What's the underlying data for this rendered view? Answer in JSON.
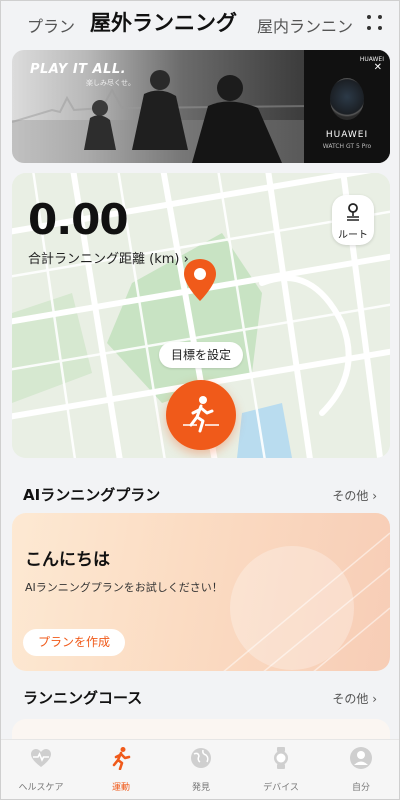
{
  "tabs": [
    {
      "label": "プラン"
    },
    {
      "label": "屋外ランニング"
    },
    {
      "label": "屋内ランニン"
    }
  ],
  "banner": {
    "slogan": "PLAY IT ALL.",
    "slogan_sub": "楽しみ尽くせ。",
    "brand_top": "HUAWEI",
    "brand": "HUAWEI",
    "model": "WATCH GT 5 Pro"
  },
  "run": {
    "distance": "0.00",
    "distance_label": "合計ランニング距離 (km) ›",
    "route_label": "ルート",
    "goal_label": "目標を設定"
  },
  "ai_plan": {
    "title": "AIランニングプラン",
    "more": "その他 ›",
    "greeting": "こんにちは",
    "message": "AIランニングプランをお試しください！",
    "button": "プランを作成"
  },
  "courses": {
    "title": "ランニングコース",
    "more": "その他 ›"
  },
  "nav": [
    {
      "label": "ヘルスケア",
      "icon": "heart-pulse-icon"
    },
    {
      "label": "運動",
      "icon": "running-icon"
    },
    {
      "label": "発見",
      "icon": "globe-icon"
    },
    {
      "label": "デバイス",
      "icon": "watch-icon"
    },
    {
      "label": "自分",
      "icon": "person-icon"
    }
  ],
  "colors": {
    "accent": "#f05a1a",
    "map_green": "#c8e3c3",
    "map_water": "#b9dcef"
  }
}
